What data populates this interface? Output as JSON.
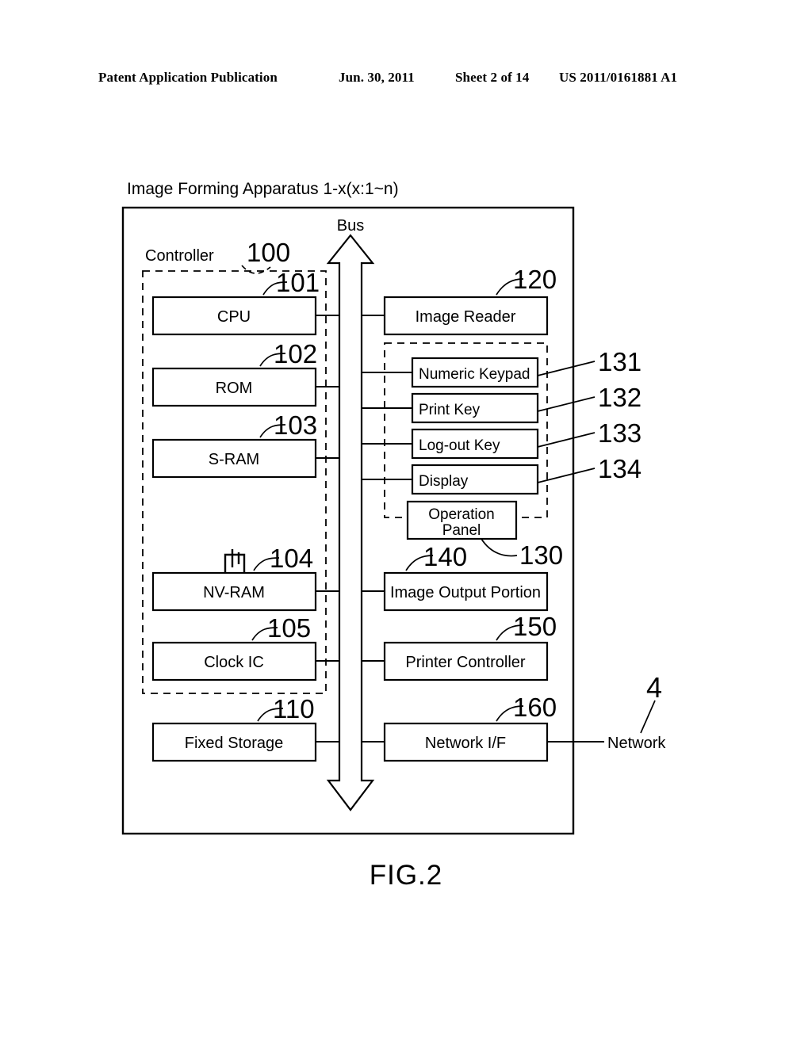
{
  "header": {
    "publication": "Patent Application Publication",
    "date": "Jun. 30, 2011",
    "sheet": "Sheet 2 of 14",
    "doc_number": "US 2011/0161881 A1"
  },
  "figure": {
    "caption": "FIG.2",
    "apparatus_title": "Image Forming Apparatus 1-x(x:1~n)",
    "bus_label": "Bus",
    "controller_label": "Controller",
    "network_label": "Network"
  },
  "reference_numerals": {
    "controller": "100",
    "cpu": "101",
    "rom": "102",
    "sram": "103",
    "nvram": "104",
    "clock_ic": "105",
    "fixed_storage": "110",
    "image_reader": "120",
    "operation_panel": "130",
    "numeric_keypad": "131",
    "print_key": "132",
    "logout_key": "133",
    "display": "134",
    "image_output_portion": "140",
    "printer_controller": "150",
    "network_if": "160",
    "network": "4"
  },
  "blocks": {
    "controller_group": [
      {
        "label": "CPU",
        "ref": "101"
      },
      {
        "label": "ROM",
        "ref": "102"
      },
      {
        "label": "S-RAM",
        "ref": "103"
      },
      {
        "label": "NV-RAM",
        "ref": "104"
      },
      {
        "label": "Clock IC",
        "ref": "105"
      }
    ],
    "left_outside": [
      {
        "label": "Fixed Storage",
        "ref": "110"
      }
    ],
    "right_column": [
      {
        "label": "Image Reader",
        "ref": "120"
      },
      {
        "label": "Image Output Portion",
        "ref": "140"
      },
      {
        "label": "Printer Controller",
        "ref": "150"
      },
      {
        "label": "Network I/F",
        "ref": "160"
      }
    ],
    "operation_panel_group": [
      {
        "label": "Numeric Keypad",
        "ref": "131"
      },
      {
        "label": "Print Key",
        "ref": "132"
      },
      {
        "label": "Log-out Key",
        "ref": "133"
      },
      {
        "label": "Display",
        "ref": "134"
      }
    ],
    "operation_panel": {
      "label_line1": "Operation",
      "label_line2": "Panel",
      "ref": "130"
    }
  }
}
